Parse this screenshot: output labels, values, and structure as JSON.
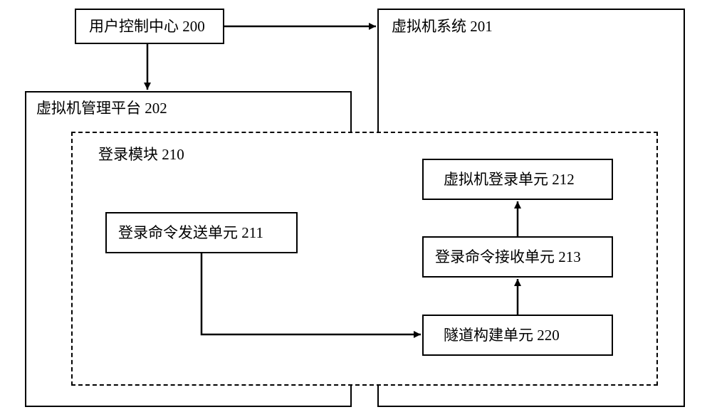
{
  "diagram": {
    "userControlCenter": "用户控制中心 200",
    "vmSystem": "虚拟机系统 201",
    "vmMgmtPlatform": "虚拟机管理平台 202",
    "loginModule": "登录模块 210",
    "loginCmdSendUnit": "登录命令发送单元 211",
    "vmLoginUnit": "虚拟机登录单元 212",
    "loginCmdRecvUnit": "登录命令接收单元 213",
    "tunnelBuildUnit": "隧道构建单元 220"
  }
}
